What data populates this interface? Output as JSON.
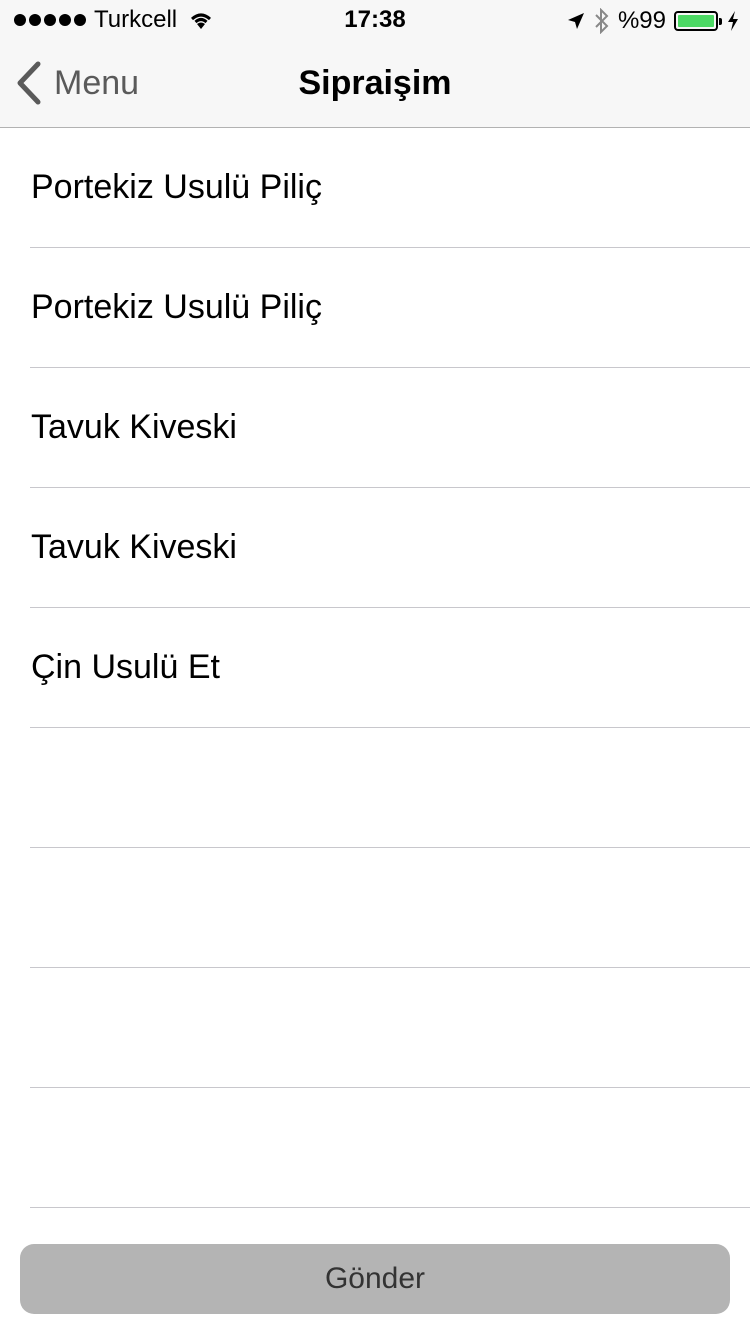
{
  "status_bar": {
    "carrier": "Turkcell",
    "time": "17:38",
    "battery_text": "%99",
    "battery_level": 0.99,
    "icons": [
      "signal-dots-icon",
      "wifi-icon",
      "location-arrow-icon",
      "bluetooth-icon",
      "battery-icon",
      "charging-bolt-icon"
    ]
  },
  "nav": {
    "back_label": "Menu",
    "title": "Sipraişim"
  },
  "order_list": {
    "items": [
      {
        "label": "Portekiz Usulü Piliç"
      },
      {
        "label": "Portekiz Usulü Piliç"
      },
      {
        "label": "Tavuk Kiveski"
      },
      {
        "label": "Tavuk Kiveski"
      },
      {
        "label": "Çin Usulü Et"
      },
      {
        "label": ""
      },
      {
        "label": ""
      },
      {
        "label": ""
      },
      {
        "label": ""
      }
    ]
  },
  "actions": {
    "send_label": "Gönder"
  },
  "colors": {
    "bar_background": "#f7f7f7",
    "separator": "#c8c7cc",
    "button_background": "#b4b4b4",
    "battery_fill": "#4cd964"
  }
}
